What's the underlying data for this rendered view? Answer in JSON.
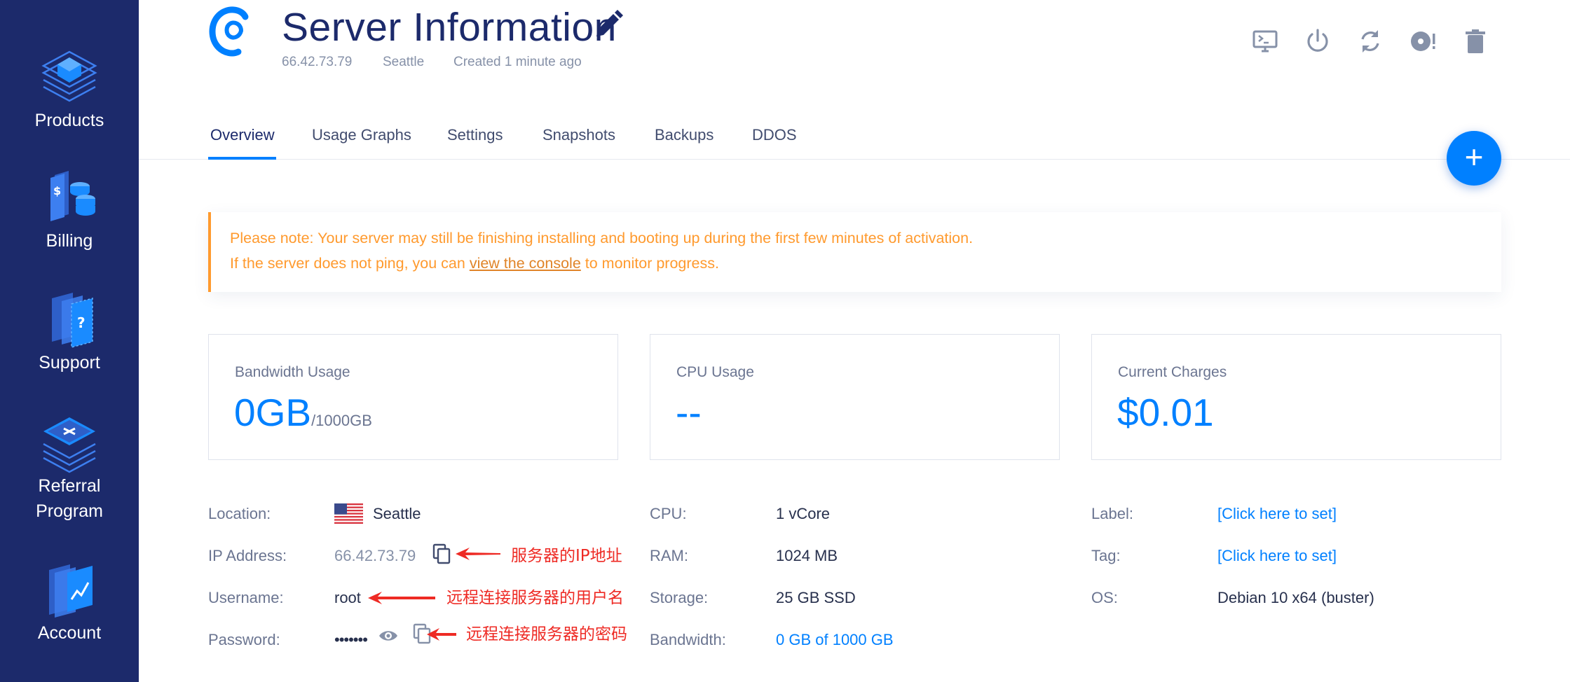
{
  "sidebar": {
    "items": [
      {
        "label": "Products",
        "icon": "products-icon"
      },
      {
        "label": "Billing",
        "icon": "billing-icon"
      },
      {
        "label": "Support",
        "icon": "support-icon"
      },
      {
        "label_line1": "Referral",
        "label_line2": "Program",
        "icon": "referral-icon"
      },
      {
        "label": "Account",
        "icon": "account-icon"
      }
    ]
  },
  "header": {
    "title": "Server Information",
    "ip": "66.42.73.79",
    "location": "Seattle",
    "created": "Created 1 minute ago",
    "actions": [
      "console-icon",
      "power-icon",
      "restart-icon",
      "reinstall-icon",
      "trash-icon"
    ]
  },
  "tabs": [
    "Overview",
    "Usage Graphs",
    "Settings",
    "Snapshots",
    "Backups",
    "DDOS"
  ],
  "active_tab": "Overview",
  "notice": {
    "line1": "Please note: Your server may still be finishing installing and booting up during the first few minutes of activation.",
    "line2_prefix": "If the server does not ping, you can ",
    "line2_link": "view the console",
    "line2_suffix": " to monitor progress."
  },
  "cards": {
    "bandwidth": {
      "label": "Bandwidth Usage",
      "value": "0GB",
      "suffix": "/1000GB"
    },
    "cpu": {
      "label": "CPU Usage",
      "value": "--"
    },
    "charges": {
      "label": "Current Charges",
      "value": "$0.01"
    }
  },
  "details": {
    "location_label": "Location:",
    "location_value": "Seattle",
    "ip_label": "IP Address:",
    "ip_value": "66.42.73.79",
    "username_label": "Username:",
    "username_value": "root",
    "password_label": "Password:",
    "password_value": "•••••••",
    "cpu_label": "CPU:",
    "cpu_value": "1 vCore",
    "ram_label": "RAM:",
    "ram_value": "1024 MB",
    "storage_label": "Storage:",
    "storage_value": "25 GB SSD",
    "bandwidth_label": "Bandwidth:",
    "bandwidth_value": "0 GB of 1000 GB",
    "label_label": "Label:",
    "label_value": "[Click here to set]",
    "tag_label": "Tag:",
    "tag_value": "[Click here to set]",
    "os_label": "OS:",
    "os_value": "Debian 10 x64 (buster)"
  },
  "annotations": {
    "ip": "服务器的IP地址",
    "username": "远程连接服务器的用户名",
    "password": "远程连接服务器的密码"
  },
  "colors": {
    "sidebar": "#1c2a6b",
    "accent": "#0080ff",
    "notice": "#ff9a2e",
    "annotation": "#ee2a24"
  }
}
